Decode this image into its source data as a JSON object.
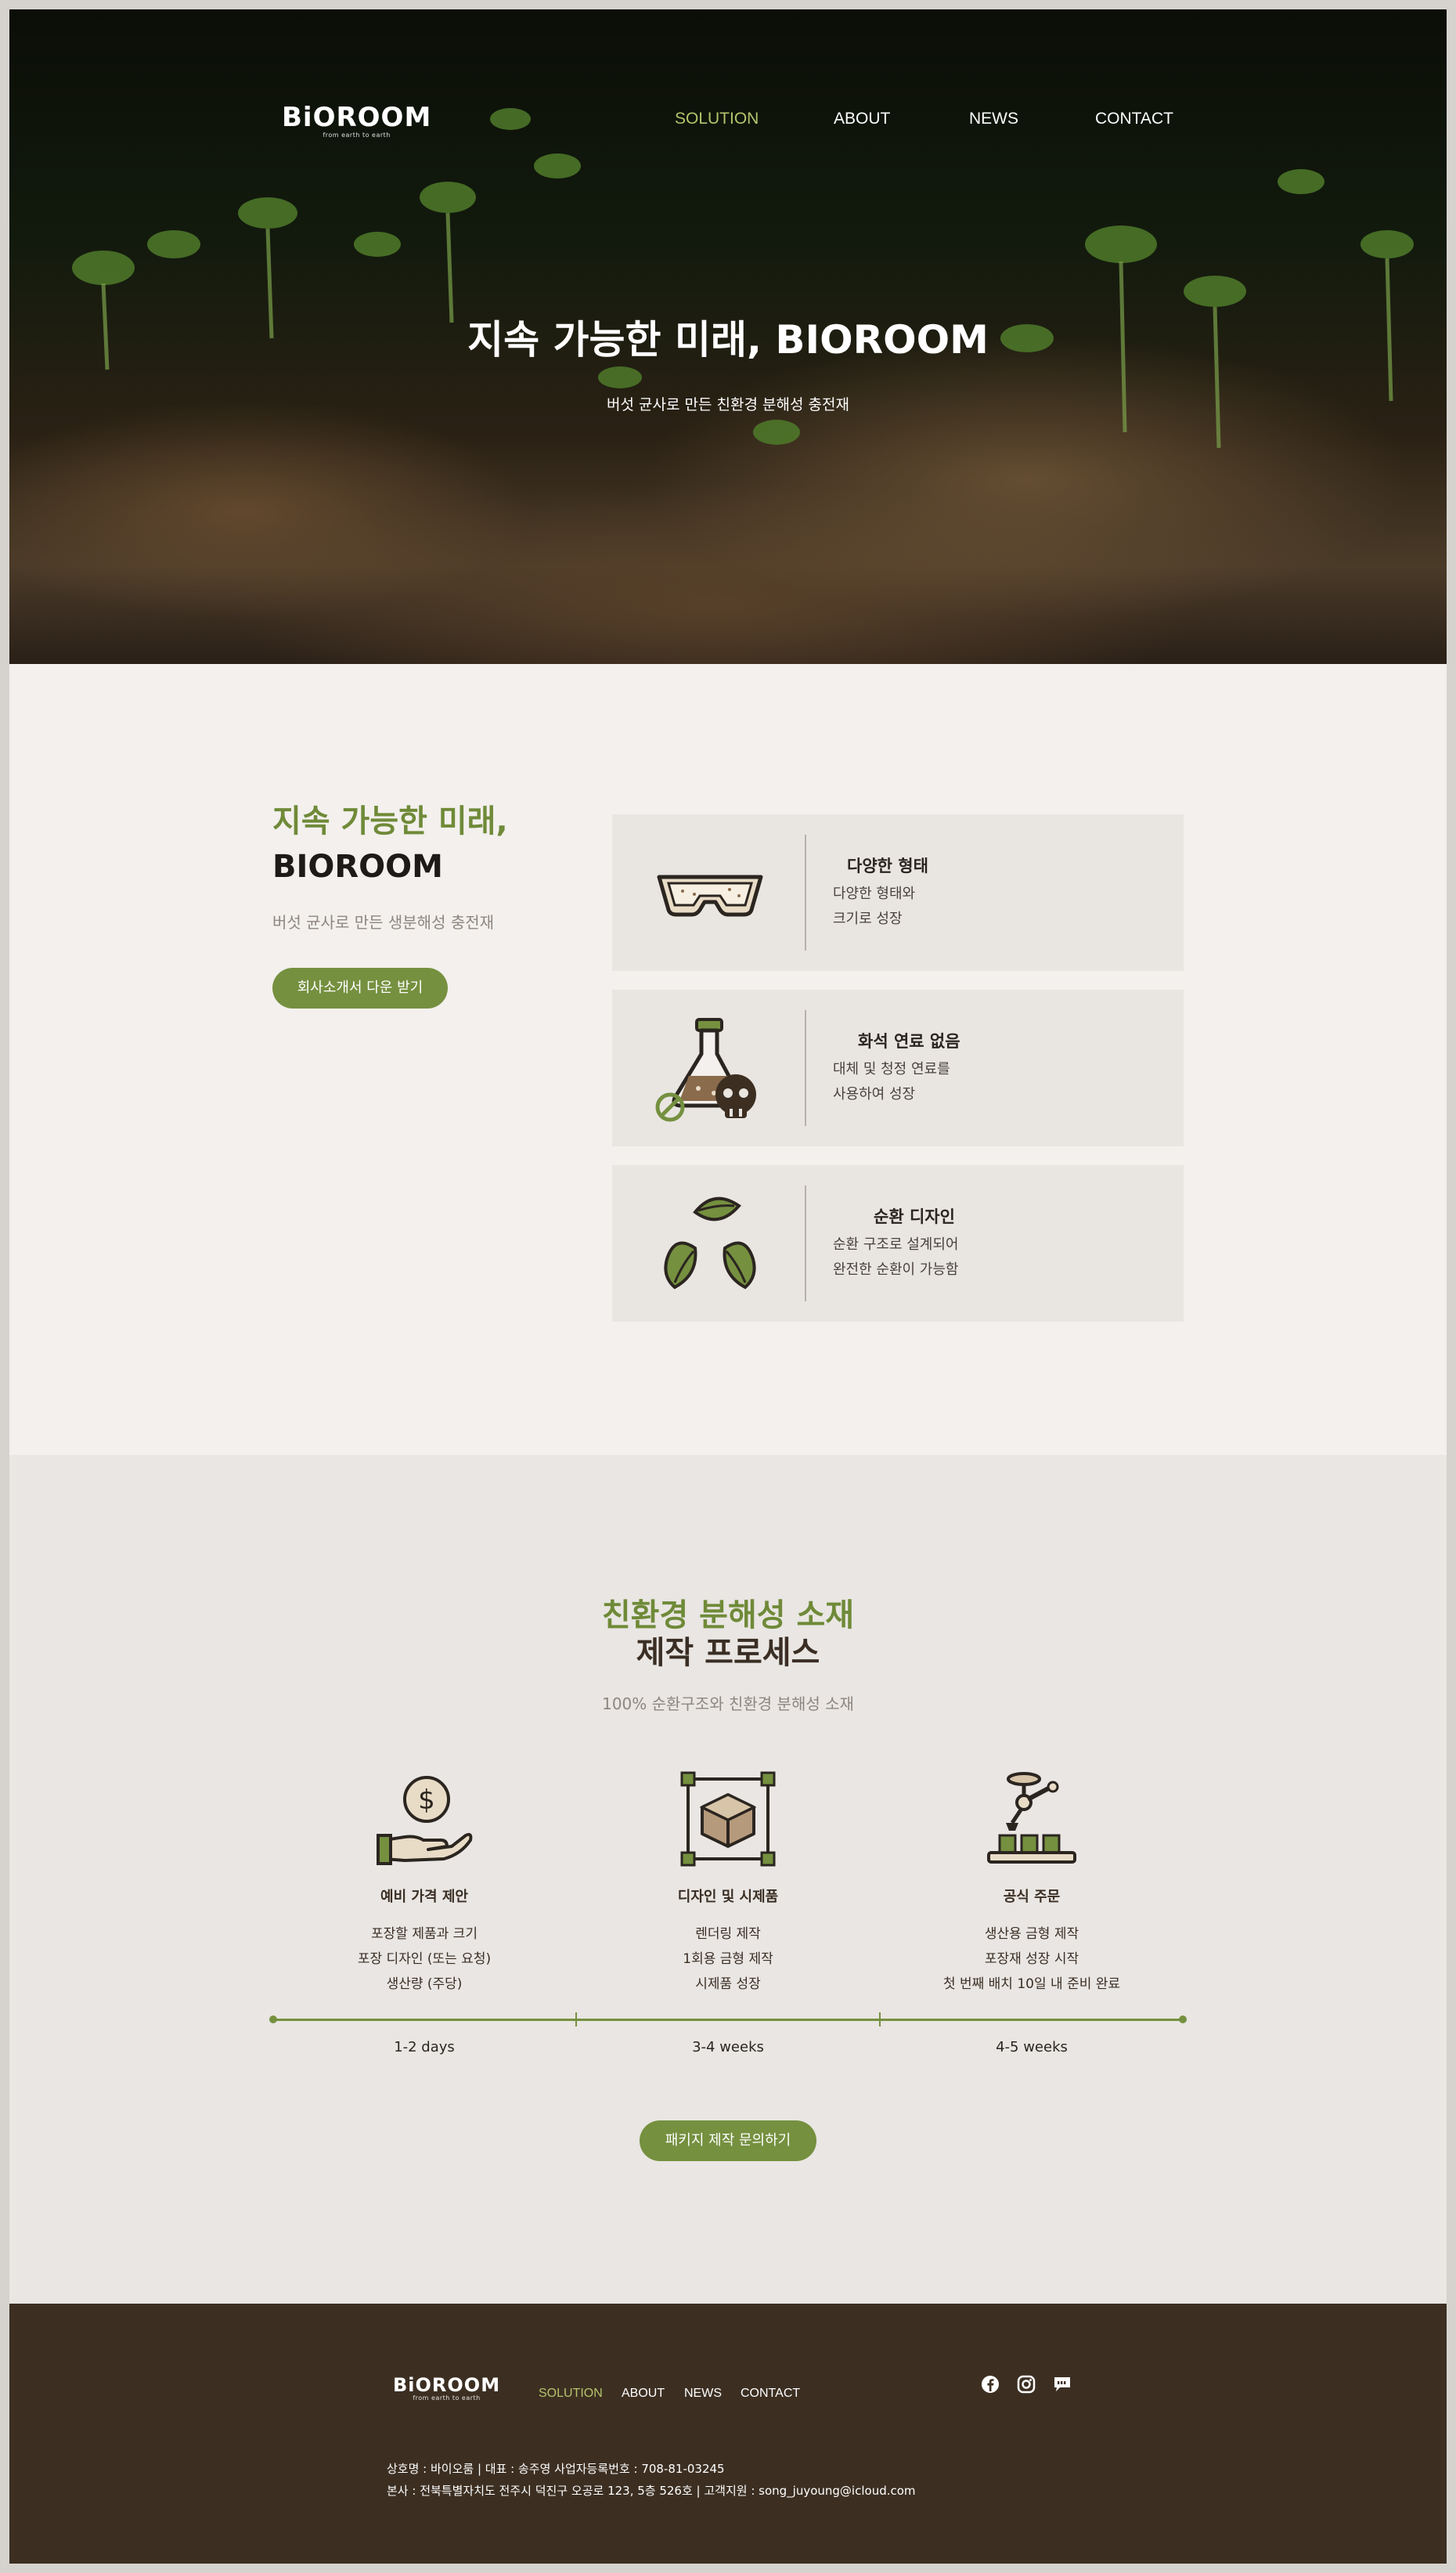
{
  "brand": {
    "name": "BiOROOM",
    "tagline": "from earth to earth"
  },
  "nav": {
    "items": [
      {
        "label": "SOLUTION",
        "active": true
      },
      {
        "label": "ABOUT",
        "active": false
      },
      {
        "label": "NEWS",
        "active": false
      },
      {
        "label": "CONTACT",
        "active": false
      }
    ]
  },
  "hero": {
    "title": "지속 가능한 미래, BIOROOM",
    "subtitle": "버섯 균사로 만든 친환경 분해성 충전재"
  },
  "features": {
    "heading_line1": "지속 가능한 미래,",
    "heading_line2": "BIOROOM",
    "subtitle": "버섯 균사로 만든 생분해성 충전재",
    "download_button": "회사소개서 다운 받기",
    "cards": [
      {
        "icon": "tray-icon",
        "title": "다양한 형태",
        "lines": [
          "다양한 형태와",
          "크기로 성장"
        ]
      },
      {
        "icon": "flask-skull-icon",
        "title": "화석 연료 없음",
        "lines": [
          "대체 및 청정 연료를",
          "사용하여 성장"
        ]
      },
      {
        "icon": "recycle-leaves-icon",
        "title": "순환 디자인",
        "lines": [
          "순환 구조로 설계되어",
          "완전한 순환이 가능함"
        ]
      }
    ]
  },
  "process": {
    "heading_line1": "친환경 분해성 소재",
    "heading_line2": "제작 프로세스",
    "subtitle": "100% 순환구조와 친환경 분해성 소재",
    "steps": [
      {
        "icon": "hand-coin-icon",
        "title": "예비 가격 제안",
        "lines": [
          "포장할 제품과 크기",
          "포장 디자인 (또는 요청)",
          "생산량 (주당)"
        ],
        "duration": "1-2 days"
      },
      {
        "icon": "design-box-icon",
        "title": "디자인 및 시제품",
        "lines": [
          "렌더링 제작",
          "1회용 금형 제작",
          "시제품 성장"
        ],
        "duration": "3-4 weeks"
      },
      {
        "icon": "robot-arm-icon",
        "title": "공식 주문",
        "lines": [
          "생산용 금형 제작",
          "포장재 성장 시작",
          "첫 번째 배치 10일 내 준비 완료"
        ],
        "duration": "4-5 weeks"
      }
    ],
    "inquiry_button": "패키지 제작 문의하기"
  },
  "footer": {
    "company_line": "상호명 : 바이오룸 | 대표 : 송주영 사업자등록번호 : 708-81-03245",
    "address_line": "본사 : 전북특별자치도 전주시 덕진구 오공로 123, 5층 526호 | 고객지원 : song_juyoung@icloud.com",
    "social_icons": [
      "facebook-icon",
      "instagram-icon",
      "kakaotalk-icon"
    ]
  },
  "colors": {
    "accent_green": "#75903f",
    "heading_green": "#6f8a38",
    "nav_active": "#b6c46b",
    "footer_bg": "#3c2f22",
    "page_bg": "#f3f0ed"
  }
}
